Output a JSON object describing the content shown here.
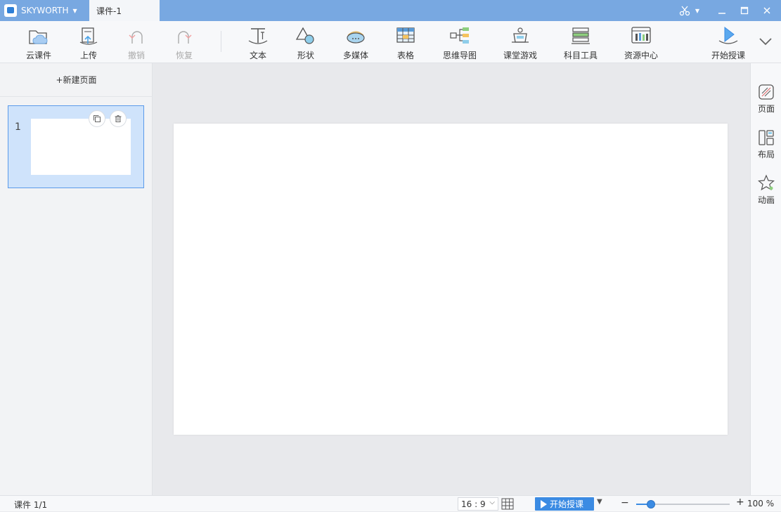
{
  "titlebar": {
    "brand": "SKYWORTH",
    "doc_tab": "课件-1"
  },
  "toolbar": {
    "items": [
      {
        "label": "云课件",
        "icon": "cloud-folder-icon",
        "enabled": true
      },
      {
        "label": "上传",
        "icon": "upload-icon",
        "enabled": true
      },
      {
        "label": "撤销",
        "icon": "undo-icon",
        "enabled": false
      },
      {
        "label": "恢复",
        "icon": "redo-icon",
        "enabled": false
      },
      {
        "label": "文本",
        "icon": "text-icon",
        "enabled": true
      },
      {
        "label": "形状",
        "icon": "shape-icon",
        "enabled": true
      },
      {
        "label": "多媒体",
        "icon": "multimedia-icon",
        "enabled": true
      },
      {
        "label": "表格",
        "icon": "table-icon",
        "enabled": true
      },
      {
        "label": "思维导图",
        "icon": "mindmap-icon",
        "enabled": true
      },
      {
        "label": "课堂游戏",
        "icon": "classroom-game-icon",
        "enabled": true
      },
      {
        "label": "科目工具",
        "icon": "subject-tools-icon",
        "enabled": true
      },
      {
        "label": "资源中心",
        "icon": "resource-center-icon",
        "enabled": true
      },
      {
        "label": "开始授课",
        "icon": "start-teaching-icon",
        "enabled": true
      }
    ]
  },
  "leftpanel": {
    "new_page": "+新建页面",
    "thumbnails": [
      {
        "number": "1"
      }
    ]
  },
  "rightpanel": {
    "items": [
      {
        "label": "页面",
        "icon": "page-icon"
      },
      {
        "label": "布局",
        "icon": "layout-icon"
      },
      {
        "label": "动画",
        "icon": "animation-star-icon"
      }
    ]
  },
  "statusbar": {
    "page_count": "课件 1/1",
    "ratio": "16 : 9",
    "start_label": "开始授课",
    "zoom_label": "100 %",
    "zoom_fraction": 0.16
  },
  "colors": {
    "titlebar": "#78a8e1",
    "accent": "#3b8be3",
    "thumb_selected": "#cfe3fb"
  }
}
